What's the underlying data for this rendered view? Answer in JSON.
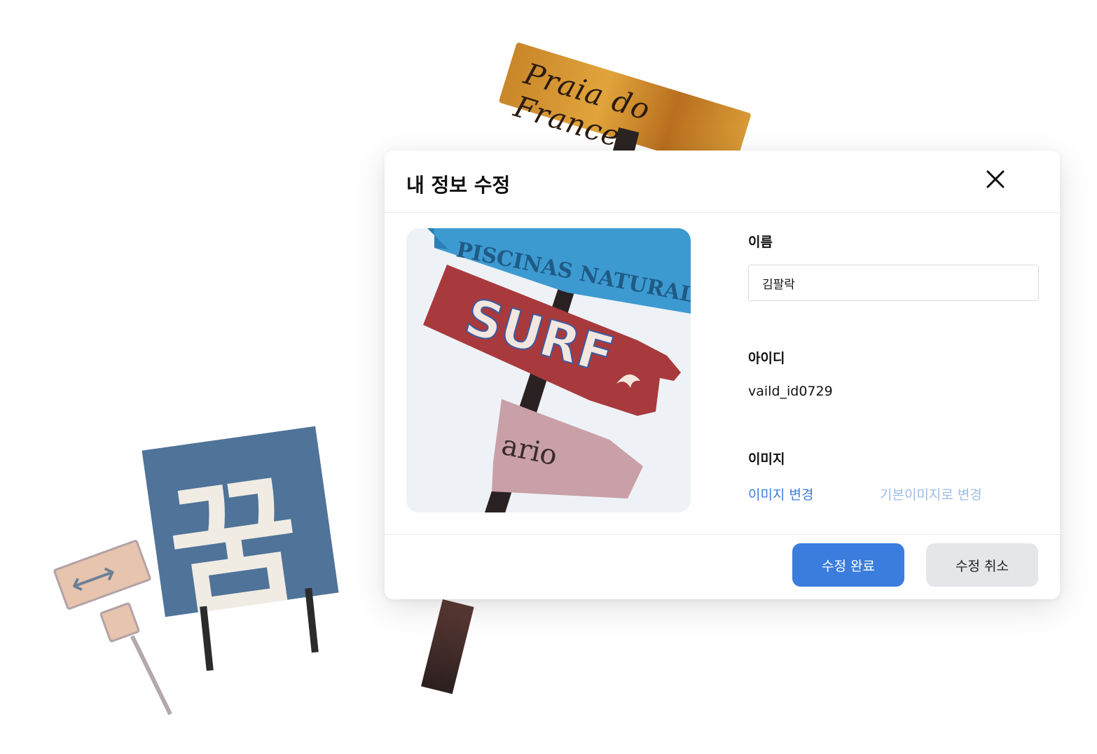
{
  "background": {
    "top_sign_text": "Praia do Frances",
    "big_sign_text": "꿈",
    "arrow_sign_glyph": "⟷"
  },
  "modal": {
    "title": "내 정보 수정",
    "close_icon": "close-icon",
    "image": {
      "sign1_text": "PISCINAS NATURAL",
      "sign2_text": "SURF",
      "sign3_text": "ario"
    },
    "fields": {
      "name_label": "이름",
      "name_value": "김팔락",
      "id_label": "아이디",
      "id_value": "vaild_id0729",
      "image_label": "이미지",
      "change_image": "이미지 변경",
      "default_image": "기본이미지로 변경"
    },
    "buttons": {
      "confirm": "수정 완료",
      "cancel": "수정 취소"
    },
    "colors": {
      "primary": "#3b7ddd",
      "secondary": "#e4e6e9",
      "link_muted": "#9cbde6"
    }
  }
}
